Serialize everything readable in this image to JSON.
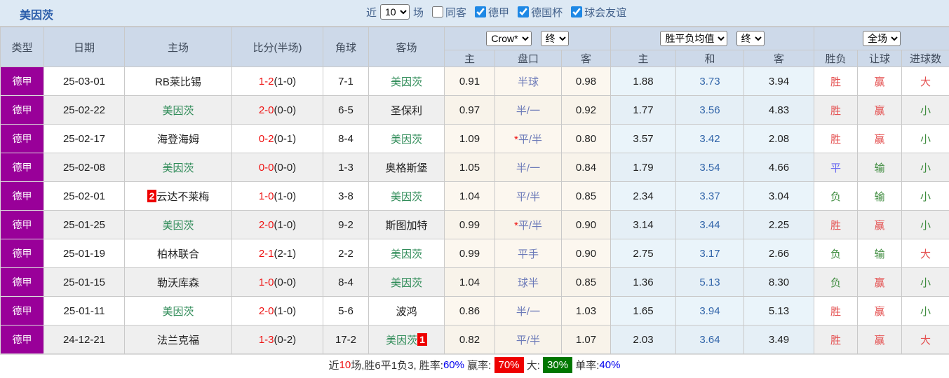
{
  "header": {
    "team": "美因茨",
    "recent_label": "近",
    "recent_value": "10",
    "games_label": "场",
    "checkboxes": [
      {
        "label": "同客",
        "checked": false
      },
      {
        "label": "德甲",
        "checked": true
      },
      {
        "label": "德国杯",
        "checked": true
      },
      {
        "label": "球会友谊",
        "checked": true
      }
    ]
  },
  "table": {
    "static_headers": [
      "类型",
      "日期",
      "主场",
      "比分(半场)",
      "角球",
      "客场"
    ],
    "groups": [
      {
        "selects": [
          "Crow*",
          "终"
        ],
        "cols": [
          "主",
          "盘口",
          "客"
        ]
      },
      {
        "selects": [
          "胜平负均值",
          "终"
        ],
        "cols": [
          "主",
          "和",
          "客"
        ]
      },
      {
        "selects": [
          "全场"
        ],
        "cols": [
          "胜负",
          "让球",
          "进球数"
        ]
      }
    ],
    "rows": [
      {
        "league": "德甲",
        "date": "25-03-01",
        "home": "RB莱比锡",
        "home_green": false,
        "home_badge": "",
        "score": "1-2",
        "half": "(1-0)",
        "corners": "7-1",
        "away": "美因茨",
        "away_green": true,
        "away_badge": "",
        "odds_home": "0.91",
        "handicap_star": false,
        "handicap": "半球",
        "odds_away": "0.98",
        "avg_home": "1.88",
        "avg_draw": "3.73",
        "avg_away": "3.94",
        "result": "胜",
        "let_result": "赢",
        "goals": "大"
      },
      {
        "league": "德甲",
        "date": "25-02-22",
        "home": "美因茨",
        "home_green": true,
        "home_badge": "",
        "score": "2-0",
        "half": "(0-0)",
        "corners": "6-5",
        "away": "圣保利",
        "away_green": false,
        "away_badge": "",
        "odds_home": "0.97",
        "handicap_star": false,
        "handicap": "半/一",
        "odds_away": "0.92",
        "avg_home": "1.77",
        "avg_draw": "3.56",
        "avg_away": "4.83",
        "result": "胜",
        "let_result": "赢",
        "goals": "小"
      },
      {
        "league": "德甲",
        "date": "25-02-17",
        "home": "海登海姆",
        "home_green": false,
        "home_badge": "",
        "score": "0-2",
        "half": "(0-1)",
        "corners": "8-4",
        "away": "美因茨",
        "away_green": true,
        "away_badge": "",
        "odds_home": "1.09",
        "handicap_star": true,
        "handicap": "平/半",
        "odds_away": "0.80",
        "avg_home": "3.57",
        "avg_draw": "3.42",
        "avg_away": "2.08",
        "result": "胜",
        "let_result": "赢",
        "goals": "小"
      },
      {
        "league": "德甲",
        "date": "25-02-08",
        "home": "美因茨",
        "home_green": true,
        "home_badge": "",
        "score": "0-0",
        "half": "(0-0)",
        "corners": "1-3",
        "away": "奥格斯堡",
        "away_green": false,
        "away_badge": "",
        "odds_home": "1.05",
        "handicap_star": false,
        "handicap": "半/一",
        "odds_away": "0.84",
        "avg_home": "1.79",
        "avg_draw": "3.54",
        "avg_away": "4.66",
        "result": "平",
        "let_result": "输",
        "goals": "小"
      },
      {
        "league": "德甲",
        "date": "25-02-01",
        "home": "云达不莱梅",
        "home_green": false,
        "home_badge": "2",
        "score": "1-0",
        "half": "(1-0)",
        "corners": "3-8",
        "away": "美因茨",
        "away_green": true,
        "away_badge": "",
        "odds_home": "1.04",
        "handicap_star": false,
        "handicap": "平/半",
        "odds_away": "0.85",
        "avg_home": "2.34",
        "avg_draw": "3.37",
        "avg_away": "3.04",
        "result": "负",
        "let_result": "输",
        "goals": "小"
      },
      {
        "league": "德甲",
        "date": "25-01-25",
        "home": "美因茨",
        "home_green": true,
        "home_badge": "",
        "score": "2-0",
        "half": "(1-0)",
        "corners": "9-2",
        "away": "斯图加特",
        "away_green": false,
        "away_badge": "",
        "odds_home": "0.99",
        "handicap_star": true,
        "handicap": "平/半",
        "odds_away": "0.90",
        "avg_home": "3.14",
        "avg_draw": "3.44",
        "avg_away": "2.25",
        "result": "胜",
        "let_result": "赢",
        "goals": "小"
      },
      {
        "league": "德甲",
        "date": "25-01-19",
        "home": "柏林联合",
        "home_green": false,
        "home_badge": "",
        "score": "2-1",
        "half": "(2-1)",
        "corners": "2-2",
        "away": "美因茨",
        "away_green": true,
        "away_badge": "",
        "odds_home": "0.99",
        "handicap_star": false,
        "handicap": "平手",
        "odds_away": "0.90",
        "avg_home": "2.75",
        "avg_draw": "3.17",
        "avg_away": "2.66",
        "result": "负",
        "let_result": "输",
        "goals": "大"
      },
      {
        "league": "德甲",
        "date": "25-01-15",
        "home": "勒沃库森",
        "home_green": false,
        "home_badge": "",
        "score": "1-0",
        "half": "(0-0)",
        "corners": "8-4",
        "away": "美因茨",
        "away_green": true,
        "away_badge": "",
        "odds_home": "1.04",
        "handicap_star": false,
        "handicap": "球半",
        "odds_away": "0.85",
        "avg_home": "1.36",
        "avg_draw": "5.13",
        "avg_away": "8.30",
        "result": "负",
        "let_result": "赢",
        "goals": "小"
      },
      {
        "league": "德甲",
        "date": "25-01-11",
        "home": "美因茨",
        "home_green": true,
        "home_badge": "",
        "score": "2-0",
        "half": "(1-0)",
        "corners": "5-6",
        "away": "波鸿",
        "away_green": false,
        "away_badge": "",
        "odds_home": "0.86",
        "handicap_star": false,
        "handicap": "半/一",
        "odds_away": "1.03",
        "avg_home": "1.65",
        "avg_draw": "3.94",
        "avg_away": "5.13",
        "result": "胜",
        "let_result": "赢",
        "goals": "小"
      },
      {
        "league": "德甲",
        "date": "24-12-21",
        "home": "法兰克福",
        "home_green": false,
        "home_badge": "",
        "score": "1-3",
        "half": "(0-2)",
        "corners": "17-2",
        "away": "美因茨",
        "away_green": true,
        "away_badge": "1",
        "odds_home": "0.82",
        "handicap_star": false,
        "handicap": "平/半",
        "odds_away": "1.07",
        "avg_home": "2.03",
        "avg_draw": "3.64",
        "avg_away": "3.49",
        "result": "胜",
        "let_result": "赢",
        "goals": "大"
      }
    ],
    "result_color_map": {
      "胜": "c-red",
      "平": "c-blue",
      "负": "c-green",
      "赢": "c-red",
      "输": "c-green",
      "大": "c-red",
      "小": "c-green"
    }
  },
  "footer": {
    "segments": [
      {
        "text": "近",
        "style": "plain"
      },
      {
        "text": "10",
        "style": "red-text"
      },
      {
        "text": "场,胜6平1负3, 胜率:",
        "style": "plain"
      },
      {
        "text": "60%",
        "style": "blue-text"
      },
      {
        "text": " 赢率: ",
        "style": "plain"
      },
      {
        "text": "70%",
        "style": "red-bg"
      },
      {
        "text": " 大: ",
        "style": "plain"
      },
      {
        "text": "30%",
        "style": "green-bg"
      },
      {
        "text": " 单率:",
        "style": "plain"
      },
      {
        "text": "40%",
        "style": "blue-text"
      }
    ]
  },
  "colors": {
    "league_bg": "#990099",
    "team_highlight": "#2e8b57",
    "score": "#ee1111",
    "win": "#e45050",
    "draw": "#6a6af0",
    "lose": "#3d8b3d",
    "badge_bg": "#ee0000",
    "avg_draw_text": "#3366aa",
    "header_bg": "#cdd9e9",
    "topbar_bg": "#dde9f4"
  }
}
